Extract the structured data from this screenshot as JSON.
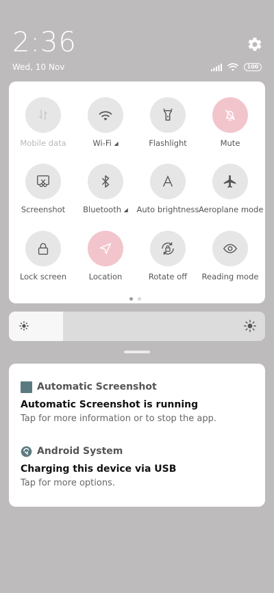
{
  "status": {
    "time": "2:36",
    "date": "Wed, 10 Nov",
    "battery": "100"
  },
  "quick_settings": {
    "tiles": [
      {
        "label": "Mobile data",
        "icon": "mobile-data-icon",
        "active": false
      },
      {
        "label": "Wi-Fi",
        "icon": "wifi-icon",
        "active": false
      },
      {
        "label": "Flashlight",
        "icon": "flashlight-icon",
        "active": false
      },
      {
        "label": "Mute",
        "icon": "bell-off-icon",
        "active": true
      },
      {
        "label": "Screenshot",
        "icon": "scissors-icon",
        "active": false
      },
      {
        "label": "Bluetooth",
        "icon": "bluetooth-icon",
        "active": false
      },
      {
        "label": "Auto brightness",
        "icon": "auto-brightness-icon",
        "active": false
      },
      {
        "label": "Aeroplane mode",
        "icon": "airplane-icon",
        "active": false
      },
      {
        "label": "Lock screen",
        "icon": "lock-icon",
        "active": false
      },
      {
        "label": "Location",
        "icon": "location-arrow-icon",
        "active": true
      },
      {
        "label": "Rotate off",
        "icon": "rotate-lock-icon",
        "active": false
      },
      {
        "label": "Reading mode",
        "icon": "eye-icon",
        "active": false
      }
    ],
    "page": 1,
    "page_count": 2
  },
  "brightness": {
    "level": 0.21
  },
  "notifications": [
    {
      "app_name": "Automatic Screenshot",
      "title": "Automatic Screenshot is running",
      "text": "Tap for more information or to stop the app.",
      "icon": "automatic-screenshot-app-icon"
    },
    {
      "app_name": "Android System",
      "title": "Charging this device via USB",
      "text": "Tap for more options.",
      "icon": "android-system-icon"
    }
  ],
  "colors": {
    "background": "#bdbbbc",
    "active_tile": "#f2c5cd",
    "inactive_tile": "#e6e6e6",
    "panel": "#ffffff"
  }
}
